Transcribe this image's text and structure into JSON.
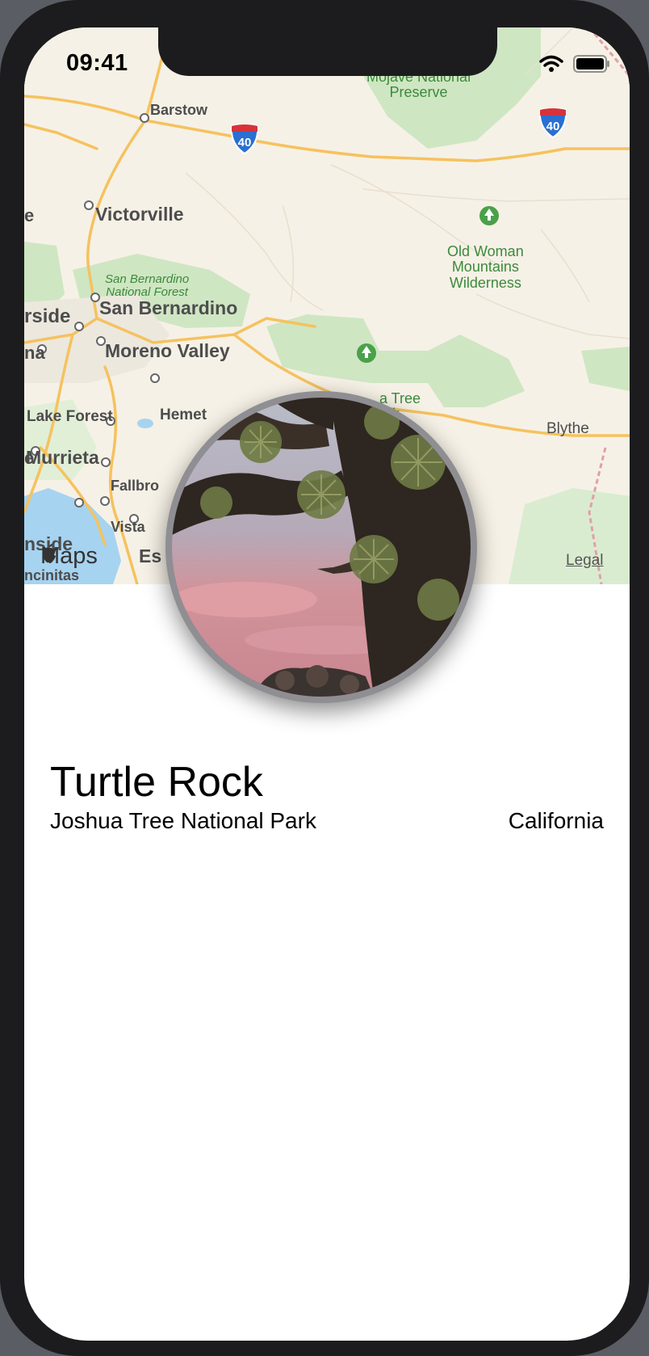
{
  "status_bar": {
    "time": "09:41",
    "icons": [
      "wifi-icon",
      "battery-icon"
    ]
  },
  "map": {
    "cities": [
      {
        "id": "barstow",
        "name": "Barstow"
      },
      {
        "id": "victorville",
        "name": "Victorville"
      },
      {
        "id": "san-bernardino",
        "name": "San Bernardino"
      },
      {
        "id": "riverside",
        "name": "rside"
      },
      {
        "id": "moreno-valley",
        "name": "Moreno Valley"
      },
      {
        "id": "lake-forest",
        "name": "Lake Forest"
      },
      {
        "id": "hemet",
        "name": "Hemet"
      },
      {
        "id": "murrieta",
        "name": "Murrieta"
      },
      {
        "id": "fallbrook",
        "name": "Fallbro"
      },
      {
        "id": "vista",
        "name": "Vista"
      },
      {
        "id": "oceanside",
        "name": "nside"
      },
      {
        "id": "encinitas",
        "name": "ncinitas"
      },
      {
        "id": "escondido",
        "name": "Es"
      },
      {
        "id": "blythe",
        "name": "Blythe"
      },
      {
        "id": "edge-e",
        "name": "e"
      },
      {
        "id": "edge-na",
        "name": "na"
      },
      {
        "id": "edge-e2",
        "name": "e"
      }
    ],
    "parks": [
      {
        "id": "mojave",
        "name": "Mojave National\nPreserve"
      },
      {
        "id": "san-bernardino-forest",
        "name": "San Bernardino\nNational Forest"
      },
      {
        "id": "old-woman",
        "name": "Old Woman\nMountains\nWilderness"
      },
      {
        "id": "joshua-tree",
        "name": "a Tree\nark"
      }
    ],
    "highway_shields": [
      "40",
      "40"
    ],
    "brand": "Maps",
    "legal": "Legal",
    "colors": {
      "land": "#f6f1e6",
      "park": "#cfe6c3",
      "road": "#f5c25f",
      "water": "#a6d3f0"
    }
  },
  "landmark": {
    "title": "Turtle Rock",
    "park": "Joshua Tree National Park",
    "state": "California"
  }
}
